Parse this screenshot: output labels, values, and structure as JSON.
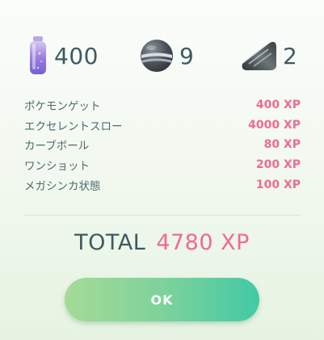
{
  "rewards": {
    "stardust": {
      "count": "400",
      "icon": "stardust-icon"
    },
    "pokeball": {
      "count": "9",
      "icon": "pokeball-icon"
    },
    "candy": {
      "count": "2",
      "icon": "candy-icon"
    }
  },
  "breakdown": [
    {
      "label": "ポケモンゲット",
      "value": "400 XP"
    },
    {
      "label": "エクセレントスロー",
      "value": "4000 XP"
    },
    {
      "label": "カーブボール",
      "value": "80 XP"
    },
    {
      "label": "ワンショット",
      "value": "200 XP"
    },
    {
      "label": "メガシンカ状態",
      "value": "100 XP"
    }
  ],
  "total": {
    "label": "TOTAL",
    "value": "4780 XP"
  },
  "ok_button": {
    "label": "OK"
  },
  "colors": {
    "accent_pink": "#f06b8e",
    "text_slate": "#3d5a61",
    "button_gradient_start": "#a5db97",
    "button_gradient_end": "#43c9a6"
  }
}
